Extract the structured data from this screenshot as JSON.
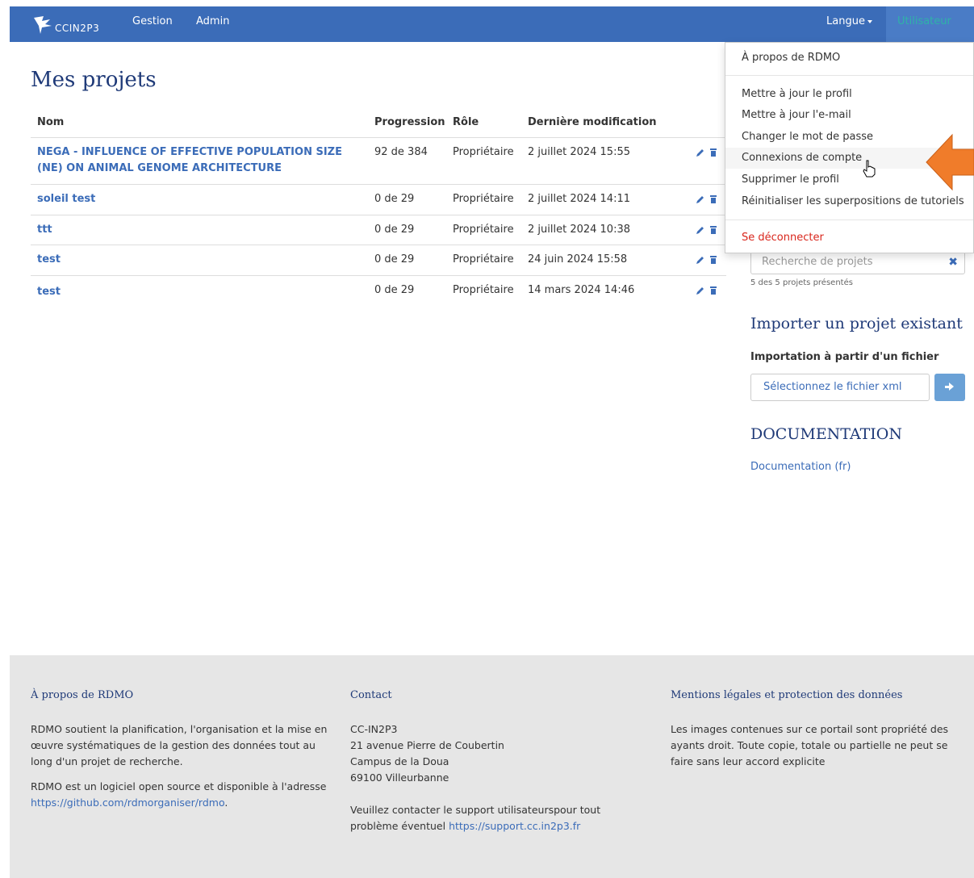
{
  "navbar": {
    "brand": "CCIN2P3",
    "links": [
      "Gestion",
      "Admin"
    ],
    "language": "Langue",
    "user": "Utilisateur"
  },
  "main": {
    "title": "Mes projets",
    "columns": [
      "Nom",
      "Progression",
      "Rôle",
      "Dernière modification"
    ],
    "rows": [
      {
        "name": "NEGA - INFLUENCE OF EFFECTIVE POPULATION SIZE (NE) ON ANIMAL GENOME ARCHITECTURE",
        "progress": "92 de 384",
        "role": "Propriétaire",
        "modified": "2 juillet 2024 15:55"
      },
      {
        "name": "soleil test",
        "progress": "0 de 29",
        "role": "Propriétaire",
        "modified": "2 juillet 2024 14:11"
      },
      {
        "name": "ttt",
        "progress": "0 de 29",
        "role": "Propriétaire",
        "modified": "2 juillet 2024 10:38"
      },
      {
        "name": "test",
        "progress": "0 de 29",
        "role": "Propriétaire",
        "modified": "24 juin 2024 15:58"
      },
      {
        "name": "test",
        "progress": "0 de 29",
        "role": "Propriétaire",
        "modified": "14 mars 2024 14:46"
      }
    ]
  },
  "sidebar": {
    "search_placeholder": "Recherche de projets",
    "search_count": "5 des 5 projets présentés",
    "import_title": "Importer un projet existant",
    "import_subtitle": "Importation à partir d'un fichier",
    "file_button": "Sélectionnez le fichier xml",
    "doc_title": "DOCUMENTATION",
    "doc_link": "Documentation (fr)"
  },
  "dropdown": {
    "about": "À propos de RDMO",
    "items": [
      "Mettre à jour le profil",
      "Mettre à jour l'e-mail",
      "Changer le mot de passe",
      "Connexions de compte",
      "Supprimer le profil",
      "Réinitialiser les superpositions de tutoriels"
    ],
    "logout": "Se déconnecter"
  },
  "footer": {
    "about_title": "À propos de RDMO",
    "about_text1": "RDMO soutient la planification, l'organisation et la mise en œuvre systématiques de la gestion des données tout au long d'un projet de recherche.",
    "about_text2": "RDMO est un logiciel open source et disponible à l'adresse",
    "about_link": "https://github.com/rdmorganiser/rdmo",
    "contact_title": "Contact",
    "contact_lines": [
      "CC-IN2P3",
      "21 avenue Pierre de Coubertin",
      "Campus de la Doua",
      "69100 Villeurbanne"
    ],
    "contact_text": "Veuillez contacter le support utilisateurspour tout problème éventuel",
    "contact_link": "https://support.cc.in2p3.fr",
    "legal_title": "Mentions légales et protection des données",
    "legal_text": "Les images contenues sur ce portail sont propriété des ayants droit. Toute copie, totale ou partielle ne peut se faire sans leur accord explicite"
  },
  "colors": {
    "navbar": "#3b6cb8",
    "heading": "#1f3a78",
    "link": "#3b6cb8",
    "logout": "#d9261c",
    "arrow": "#f07c2a",
    "footer": "#e6e6e6"
  },
  "icons": [
    "logo-icon",
    "caret-down-icon",
    "pencil-icon",
    "trash-icon",
    "close-icon",
    "arrow-right-icon",
    "hand-cursor-icon",
    "orange-arrow-icon"
  ]
}
